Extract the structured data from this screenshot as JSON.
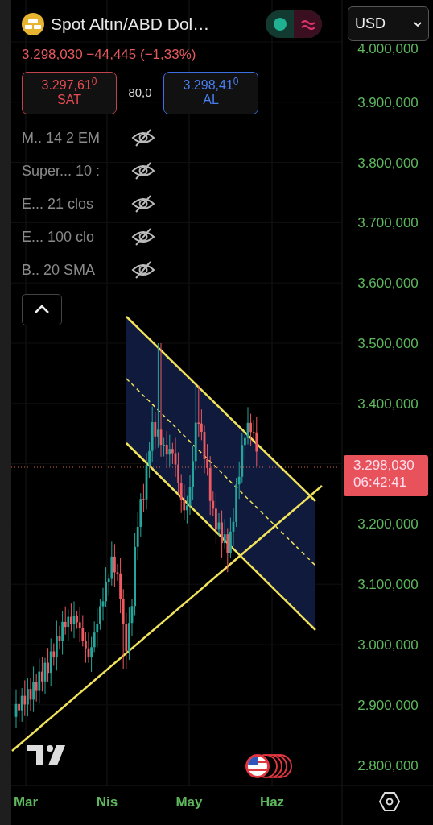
{
  "symbol": {
    "title": "Spot Altın/ABD Dol…",
    "price": "3.298,030",
    "change": "−44,445 (−1,33%)"
  },
  "market_status": {
    "open": true
  },
  "currency": {
    "value": "USD"
  },
  "sell": {
    "price": "3.297,61$^{0}$",
    "label": "SAT"
  },
  "spread": "80,0",
  "buy": {
    "price": "3.298,41$^{0}$",
    "label": "AL"
  },
  "indicators": [
    {
      "label": "M.. 14 2 EM",
      "visible": false
    },
    {
      "label": "Super... 10 :",
      "visible": false
    },
    {
      "label": "E...  21 clos",
      "visible": false
    },
    {
      "label": "E...  100 clo",
      "visible": false
    },
    {
      "label": "B.. 20 SMA",
      "visible": false
    }
  ],
  "legend_collapsed": false,
  "price_axis_upper": [
    "4.000,000",
    "3.900,000",
    "3.800,000",
    "3.700,000",
    "3.600,000",
    "3.500,000",
    "3.400,000"
  ],
  "price_axis_lower": [
    "3.200,000",
    "3.100,000",
    "3.000,000",
    "2.900,000",
    "2.800,000"
  ],
  "last_price": {
    "price": "3.298,030",
    "countdown": "06:42:41"
  },
  "time_axis": [
    "Mar",
    "Nis",
    "May",
    "Haz"
  ]
}
